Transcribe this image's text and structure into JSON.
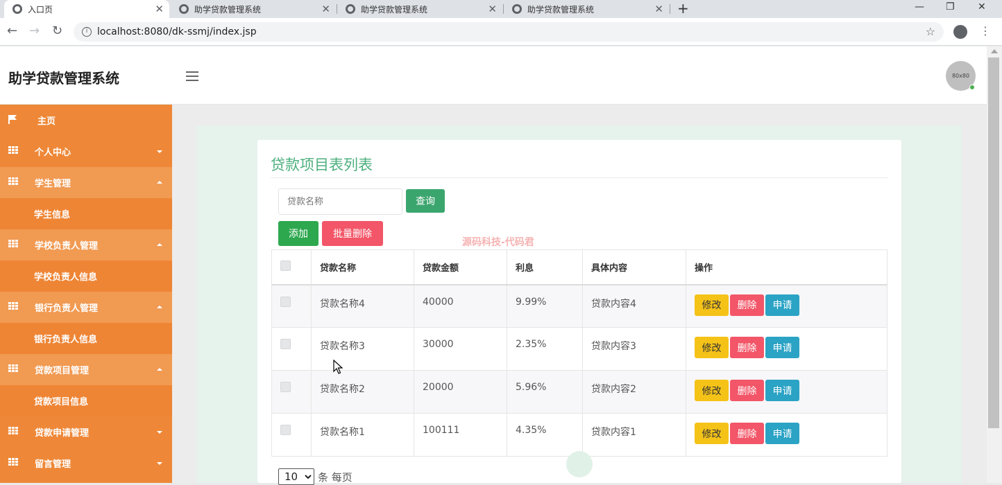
{
  "browser": {
    "tabs": [
      {
        "title": "入口页",
        "active": true
      },
      {
        "title": "助学贷款管理系统",
        "active": false
      },
      {
        "title": "助学贷款管理系统",
        "active": false
      },
      {
        "title": "助学贷款管理系统",
        "active": false
      }
    ],
    "url": "localhost:8080/dk-ssmj/index.jsp",
    "new_tab": "+",
    "close_glyph": "✕"
  },
  "header": {
    "brand": "助学贷款管理系统",
    "avatar_text": "80x80"
  },
  "sidebar": {
    "items": [
      {
        "label": "主页",
        "icon": "flag-icon",
        "type": "top"
      },
      {
        "label": "个人中心",
        "icon": "grid-icon",
        "type": "group",
        "expanded": false
      },
      {
        "label": "学生管理",
        "icon": "grid-icon",
        "type": "group",
        "expanded": true
      },
      {
        "label": "学生信息",
        "type": "sub"
      },
      {
        "label": "学校负责人管理",
        "icon": "grid-icon",
        "type": "group",
        "expanded": true
      },
      {
        "label": "学校负责人信息",
        "type": "sub"
      },
      {
        "label": "银行负责人管理",
        "icon": "grid-icon",
        "type": "group",
        "expanded": true
      },
      {
        "label": "银行负责人信息",
        "type": "sub"
      },
      {
        "label": "贷款项目管理",
        "icon": "grid-icon",
        "type": "group",
        "expanded": true
      },
      {
        "label": "贷款项目信息",
        "type": "sub"
      },
      {
        "label": "贷款申请管理",
        "icon": "grid-icon",
        "type": "group",
        "expanded": false
      },
      {
        "label": "留言管理",
        "icon": "grid-icon",
        "type": "group",
        "expanded": false
      }
    ]
  },
  "main": {
    "title": "贷款项目表列表",
    "search": {
      "placeholder": "贷款名称",
      "value": ""
    },
    "query_label": "查询",
    "add_label": "添加",
    "batch_delete_label": "批量删除",
    "watermark": "源码科技-代码君",
    "table": {
      "columns": [
        "贷款名称",
        "贷款金额",
        "利息",
        "具体内容",
        "操作"
      ],
      "rows": [
        {
          "name": "贷款名称4",
          "amount": "40000",
          "interest": "9.99%",
          "content": "贷款内容4"
        },
        {
          "name": "贷款名称3",
          "amount": "30000",
          "interest": "2.35%",
          "content": "贷款内容3"
        },
        {
          "name": "贷款名称2",
          "amount": "20000",
          "interest": "5.96%",
          "content": "贷款内容2"
        },
        {
          "name": "贷款名称1",
          "amount": "100111",
          "interest": "4.35%",
          "content": "贷款内容1"
        }
      ],
      "actions": {
        "edit": "修改",
        "delete": "删除",
        "apply": "申请"
      }
    },
    "pager": {
      "page_size": "10",
      "suffix": "条 每页"
    }
  },
  "colors": {
    "sidebar": "#ee8838",
    "title": "#4caf7d",
    "edit": "#f5c218",
    "delete": "#f25668",
    "apply": "#2ba3c5",
    "add": "#2ea84f"
  }
}
